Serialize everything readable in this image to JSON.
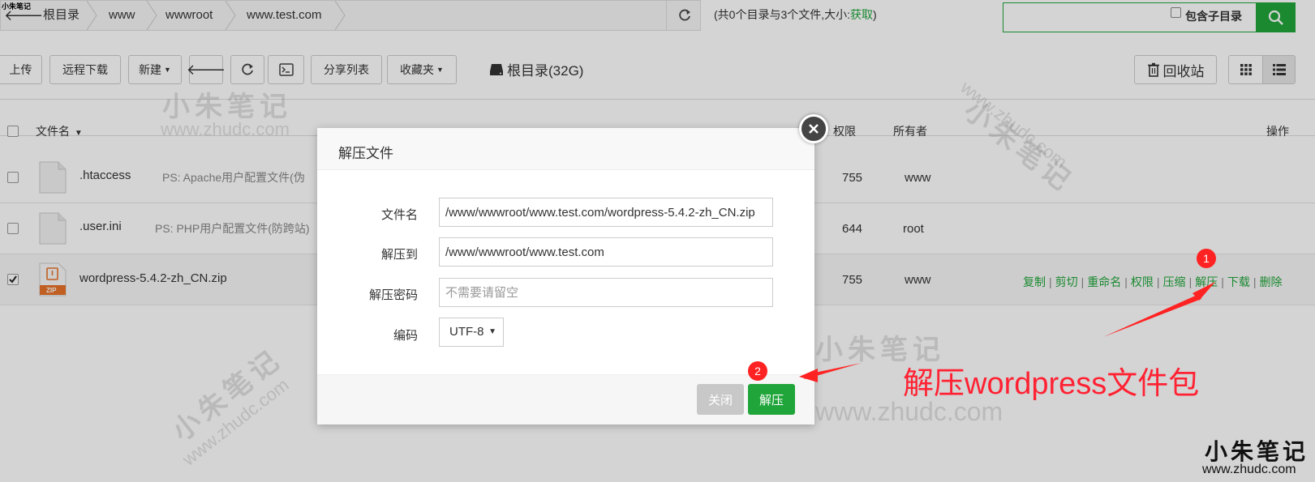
{
  "path": {
    "crumbs": [
      "根目录",
      "www",
      "wwwroot",
      "www.test.com"
    ],
    "summary_prefix": "(共0个目录与3个文件,大小:",
    "summary_link": "获取",
    "summary_suffix": ")"
  },
  "search": {
    "placeholder": "",
    "subdir_label": "包含子目录"
  },
  "toolbar": {
    "upload": "上传",
    "remote_download": "远程下载",
    "new": "新建",
    "share_list": "分享列表",
    "favorites": "收藏夹",
    "disk": "根目录(32G)",
    "recycle_bin": "回收站"
  },
  "table": {
    "headers": {
      "name": "文件名",
      "perm": "权限",
      "owner": "所有者",
      "ops": "操作"
    },
    "rows": [
      {
        "name": ".htaccess",
        "desc": "PS: Apache用户配置文件(伪",
        "perm": "755",
        "owner": "www",
        "checked": false
      },
      {
        "name": ".user.ini",
        "desc": "PS: PHP用户配置文件(防跨站)",
        "perm": "644",
        "owner": "root",
        "checked": false
      },
      {
        "name": "wordpress-5.4.2-zh_CN.zip",
        "desc": "",
        "perm": "755",
        "owner": "www",
        "checked": true,
        "icon_label": "ZIP"
      }
    ],
    "ops": [
      "复制",
      "剪切",
      "重命名",
      "权限",
      "压缩",
      "解压",
      "下载",
      "删除"
    ]
  },
  "modal": {
    "title": "解压文件",
    "filename_label": "文件名",
    "filename_value": "/www/wwwroot/www.test.com/wordpress-5.4.2-zh_CN.zip",
    "extract_to_label": "解压到",
    "extract_to_value": "/www/wwwroot/www.test.com",
    "password_label": "解压密码",
    "password_placeholder": "不需要请留空",
    "encoding_label": "编码",
    "encoding_value": "UTF-8",
    "close_label": "关闭",
    "extract_label": "解压"
  },
  "annotations": {
    "badge1": "1",
    "badge2": "2",
    "caption": "解压wordpress文件包",
    "color": "#ff2222"
  },
  "watermark": {
    "cn": "小朱笔记",
    "url": "www.zhudc.com"
  },
  "colors": {
    "accent": "#20a53a"
  }
}
